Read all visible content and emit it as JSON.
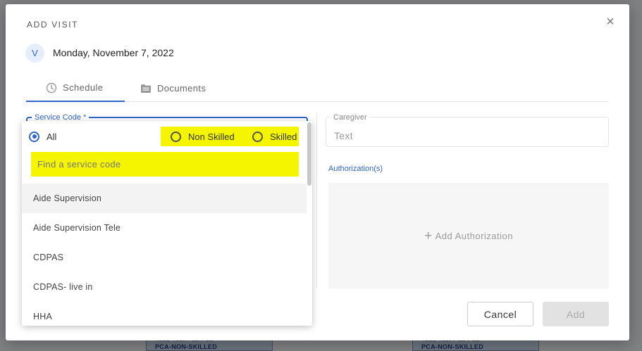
{
  "background": {
    "cells": [
      {
        "line1": "Test, Test Pca Pca",
        "line2": "PCA-NON-SKILLED"
      },
      {
        "line1": "Test, Test Pca Pca",
        "line2": "PCA-NON-SKILLED"
      }
    ]
  },
  "modal": {
    "title": "ADD VISIT",
    "close_icon": "×",
    "avatar_initial": "V",
    "date": "Monday, November 7, 2022",
    "tabs": [
      {
        "label": "Schedule",
        "icon": "clock-icon",
        "active": true
      },
      {
        "label": "Documents",
        "icon": "folder-icon",
        "active": false
      }
    ]
  },
  "service_code": {
    "label": "Service Code *",
    "filters": [
      {
        "label": "All",
        "checked": true
      },
      {
        "label": "Non Skilled",
        "checked": false
      },
      {
        "label": "Skilled",
        "checked": false
      }
    ],
    "search_placeholder": "Find a service code",
    "items": [
      "Aide Supervision",
      "Aide Supervision Tele",
      "CDPAS",
      "CDPAS- live in",
      "HHA"
    ]
  },
  "caregiver": {
    "label": "Caregiver",
    "value": "Text"
  },
  "authorization": {
    "label": "Authorization(s)",
    "add_label": "Add Authorization"
  },
  "buttons": {
    "cancel": "Cancel",
    "add": "Add"
  },
  "colors": {
    "accent": "#2f66c7",
    "highlight": "#f5f500"
  }
}
